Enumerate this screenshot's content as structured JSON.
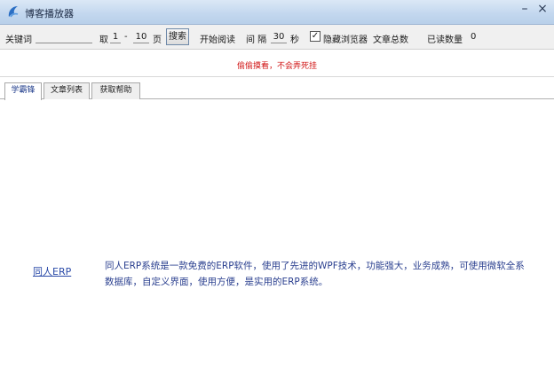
{
  "window": {
    "title": "博客播放器",
    "minimize_label": "–",
    "close_label": "×"
  },
  "toolbar": {
    "keyword_label": "关键词",
    "keyword_value": "",
    "take_label": "取",
    "page_from": "1",
    "range_sep": "-",
    "page_to": "10",
    "page_unit": "页",
    "search_label": "搜索",
    "start_label": "开始阅读",
    "interval_label": "间 隔",
    "interval_value": "30",
    "interval_unit": "秒",
    "hide_browser_checked": "✓",
    "hide_browser_label": "隐藏浏览器",
    "total_label": "文章总数",
    "read_label": "已读数量",
    "read_value": "0"
  },
  "notice": {
    "text": "偷偷摸看，不会弄死挂"
  },
  "tabs": [
    {
      "label": "学霸锋",
      "active": true
    },
    {
      "label": "文章列表",
      "active": false
    },
    {
      "label": "获取帮助",
      "active": false
    }
  ],
  "content": {
    "link_text": "同人ERP",
    "description": "同人ERP系统是一款免费的ERP软件，使用了先进的WPF技术，功能强大，业务成熟，可使用微软全系数据库，自定义界面，使用方便，是实用的ERP系统。"
  }
}
